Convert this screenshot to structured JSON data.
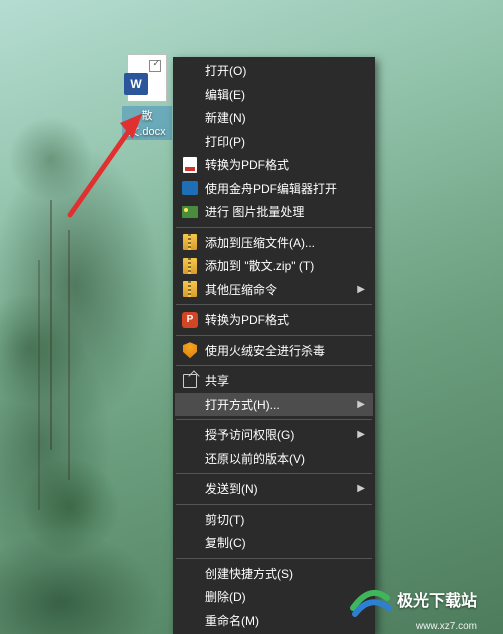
{
  "file": {
    "label": "散文.docx",
    "badge": "W"
  },
  "menu": {
    "open": "打开(O)",
    "edit": "编辑(E)",
    "new": "新建(N)",
    "print": "打印(P)",
    "convert_pdf_1": "转换为PDF格式",
    "jinzhou_pdf": "使用金舟PDF编辑器打开",
    "batch_image": "进行 图片批量处理",
    "add_archive": "添加到压缩文件(A)...",
    "add_zip": "添加到 \"散文.zip\" (T)",
    "other_archive": "其他压缩命令",
    "convert_pdf_2": "转换为PDF格式",
    "huorong": "使用火绒安全进行杀毒",
    "share": "共享",
    "open_with": "打开方式(H)...",
    "grant_access": "授予访问权限(G)",
    "restore_version": "还原以前的版本(V)",
    "send_to": "发送到(N)",
    "cut": "剪切(T)",
    "copy": "复制(C)",
    "create_shortcut": "创建快捷方式(S)",
    "delete": "删除(D)",
    "rename": "重命名(M)",
    "ppt_badge": "P"
  },
  "watermark": {
    "text": "极光下载站",
    "url": "www.xz7.com"
  }
}
